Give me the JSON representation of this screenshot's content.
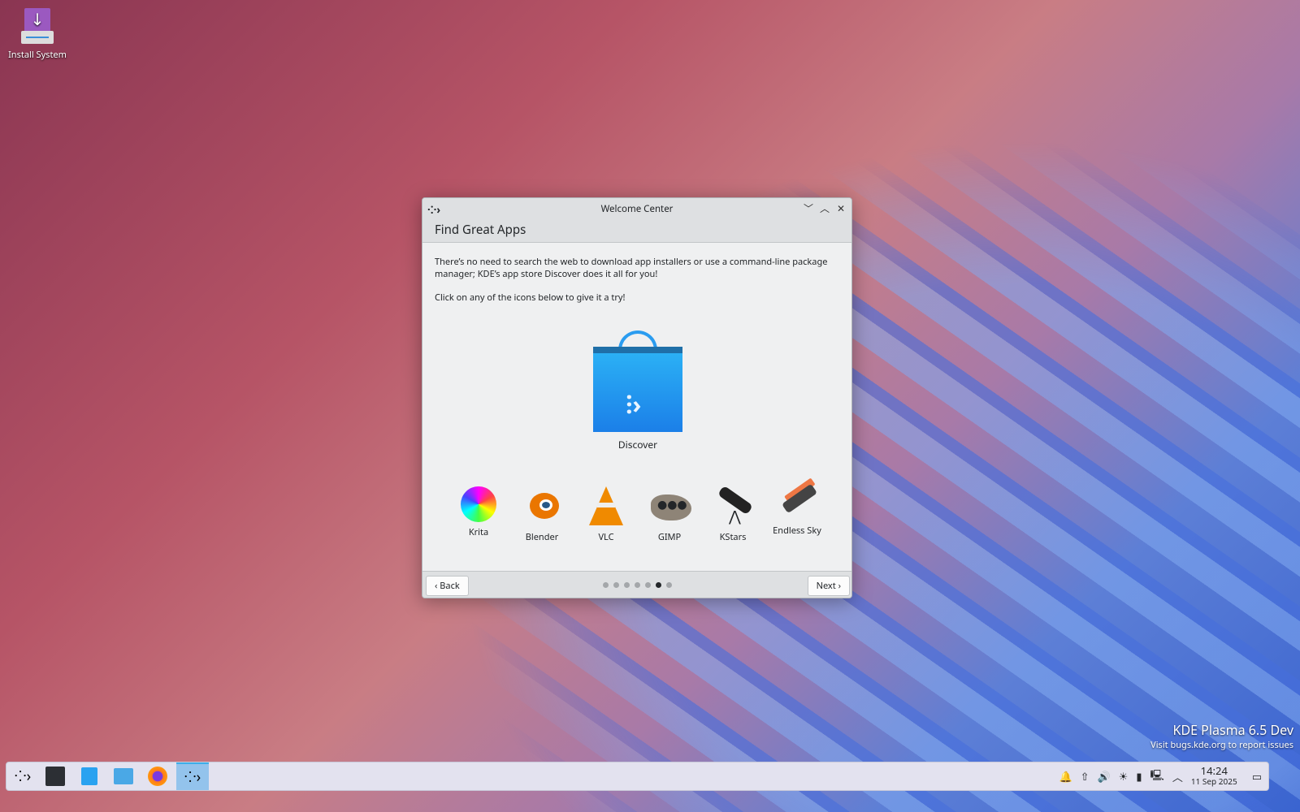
{
  "desktop": {
    "icons": [
      {
        "label": "Install System",
        "icon": "install-icon"
      }
    ],
    "watermark": {
      "title": "KDE Plasma 6.5 Dev",
      "subtitle": "Visit bugs.kde.org to report issues"
    }
  },
  "window": {
    "title": "Welcome Center",
    "page_title": "Find Great Apps",
    "paragraphs": [
      "There’s no need to search the web to download app installers or use a command-line package manager; KDE’s app store Discover does it all for you!",
      "Click on any of the icons below to give it a try!"
    ],
    "featured": {
      "label": "Discover",
      "icon": "discover-icon"
    },
    "apps": [
      {
        "label": "Krita"
      },
      {
        "label": "Blender"
      },
      {
        "label": "VLC"
      },
      {
        "label": "GIMP"
      },
      {
        "label": "KStars"
      },
      {
        "label": "Endless Sky"
      }
    ],
    "back_label": "Back",
    "next_label": "Next",
    "page": {
      "current": 6,
      "total": 7
    }
  },
  "taskbar": {
    "items": [
      "application-launcher",
      "system-settings",
      "discover",
      "dolphin",
      "firefox",
      "welcome-center"
    ],
    "clock": {
      "time": "14:24",
      "date": "11 Sep 2025"
    }
  }
}
